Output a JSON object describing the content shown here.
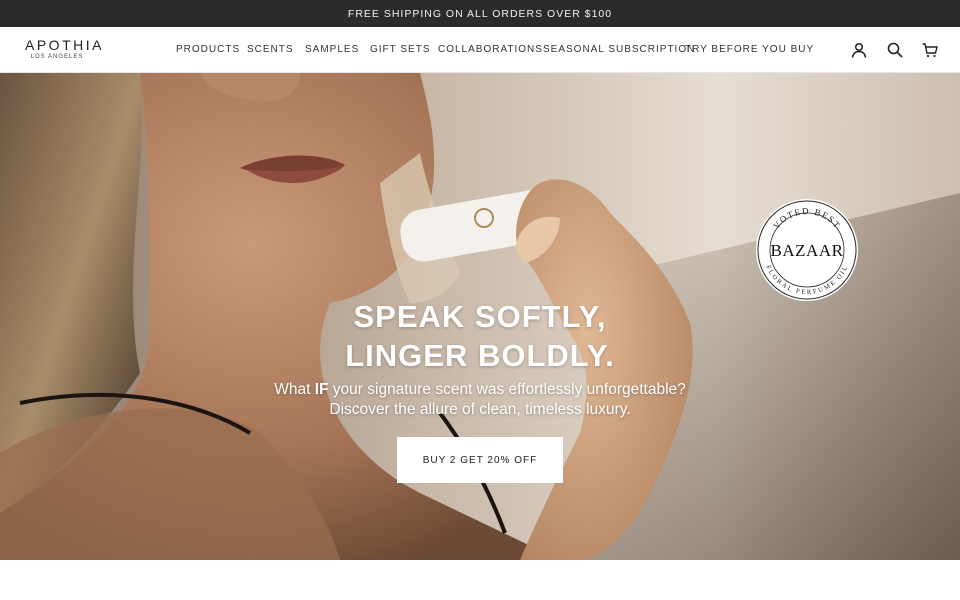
{
  "announcement": "FREE SHIPPING ON ALL ORDERS OVER $100",
  "logo": {
    "name": "APOTHIA",
    "tagline": "LOS ANGELES"
  },
  "nav": [
    "PRODUCTS",
    "SCENTS",
    "SAMPLES",
    "GIFT SETS",
    "COLLABORATIONS",
    "SEASONAL SUBSCRIPTION",
    "TRY BEFORE YOU BUY"
  ],
  "header_icons": [
    "account-icon",
    "search-icon",
    "cart-icon"
  ],
  "hero": {
    "title": "SPEAK SOFTLY, LINGER BOLDLY.",
    "subtitle_pre": "What ",
    "subtitle_bold": "IF",
    "subtitle_post": " your signature scent was effortlessly unforgettable? Discover the allure of clean, timeless luxury.",
    "cta": "BUY 2 GET 20% OFF"
  },
  "badge": {
    "top": "VOTED BEST",
    "center": "BAZAAR",
    "bottom": "FLORAL PERFUME OIL"
  },
  "slides": {
    "count": 2,
    "active": 1
  },
  "colors": {
    "announcement_bg": "#2b2b2b",
    "header_bg": "#ffffff",
    "cta_bg": "#ffffff"
  }
}
